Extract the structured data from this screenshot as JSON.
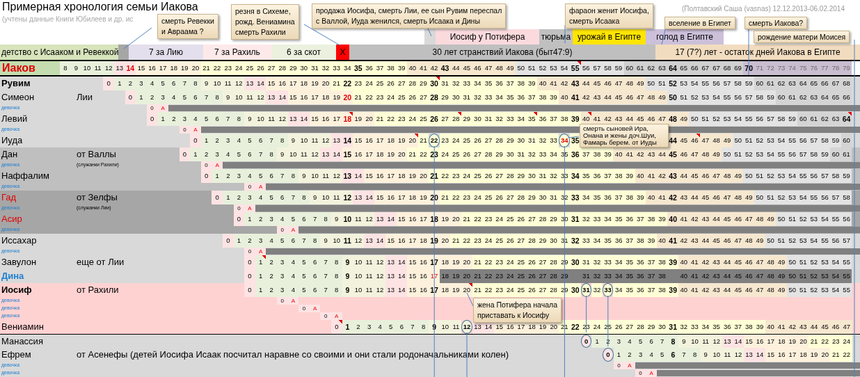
{
  "title": "Примерная хронология семьи Иакова",
  "subtitle": "(учтены данные Книги Юбилеев и др. ис",
  "author": "(Полтавский Саша (vasnas) 12.12.2013-06.02.2014",
  "periods_top": [
    {
      "color": "#d9d9d9"
    },
    {
      "text": "Иосиф у Потифера",
      "color": "#fadadd"
    },
    {
      "text": "тюрьма",
      "color": "#c0c0c0"
    },
    {
      "text": "урожай в Египте",
      "color": "#ffe500"
    },
    {
      "text": "голод в Египте",
      "color": "#ccc0da"
    }
  ],
  "periods": [
    {
      "text": "детство с Исааком и Ревеккой",
      "color": "#d7e4bc"
    },
    {
      "color": "#a6a6a6"
    },
    {
      "text": "7 за Лию",
      "color": "#e4dfec"
    },
    {
      "text": "7 за Рахиль",
      "color": "#fde9e9"
    },
    {
      "text": "6 за скот",
      "color": "#ebf1de"
    },
    {
      "text": "X",
      "color": "#ff0000"
    },
    {
      "text": "30 лет странствий Иакова (быт47:9)",
      "color": "#bfbfbf"
    },
    {
      "text": "17 (7?) лет - остаток дней Иакова в Египте",
      "color": "#f2dcc0"
    }
  ],
  "jacob": {
    "name": "Иаков",
    "cells": [
      "8",
      "9",
      "10",
      "11",
      "12",
      "13",
      {
        "t": "14",
        "bold": true,
        "red": true
      },
      "15",
      "16",
      "17",
      "18",
      "19",
      "20",
      "21",
      "22",
      "23",
      "24",
      "25",
      "26",
      "27",
      "28",
      "29",
      "30",
      "31",
      "32",
      "33",
      "34",
      {
        "t": "35",
        "bold": true
      },
      "36",
      "37",
      "38",
      "39",
      "40",
      "41",
      "42",
      {
        "t": "43",
        "bold": true
      },
      "44",
      "45",
      "46",
      "47",
      "48",
      "49",
      "50",
      "51",
      "52",
      "53",
      "54",
      {
        "t": "55",
        "bold": true,
        "flag": true
      },
      "56",
      "57",
      "58",
      "59",
      "60",
      "61",
      "62",
      "63",
      {
        "t": "64",
        "bold": true
      },
      "65",
      "66",
      "67",
      "67",
      "68",
      "69",
      {
        "t": "70",
        "bold": true
      },
      {
        "t": "71",
        "dim": true
      },
      {
        "t": "72",
        "dim": true
      },
      {
        "t": "73",
        "dim": true
      },
      {
        "t": "74",
        "dim": true
      },
      {
        "t": "75",
        "dim": true
      },
      {
        "t": "76",
        "dim": true
      },
      {
        "t": "77",
        "dim": true
      },
      {
        "t": "78",
        "dim": true
      },
      {
        "t": "79",
        "dim": true
      }
    ]
  },
  "rows": [
    {
      "kind": "son",
      "name": "Рувим",
      "bold": true,
      "color": "#d9d9d9",
      "cells": [
        null,
        null,
        null,
        null,
        "0",
        "1",
        "2",
        "3",
        "4",
        "5",
        "6",
        "7",
        "8",
        "9",
        "10",
        "11",
        "12",
        "13",
        "14",
        "15",
        "16",
        "17",
        "18",
        "19",
        "20",
        "21",
        {
          "t": "22",
          "bold": true
        },
        "23",
        "24",
        "25",
        "26",
        "27",
        "28",
        "29",
        {
          "t": "30",
          "bold": true,
          "flag": true
        },
        "31",
        "32",
        "33",
        "34",
        "35",
        "36",
        "37",
        "38",
        "39",
        "40",
        "41",
        "42",
        {
          "t": "43",
          "bold": true
        },
        "44",
        "45",
        "46",
        "47",
        "48",
        "49",
        "50",
        "51",
        {
          "t": "52",
          "bold": true
        },
        "53",
        "54",
        "55",
        "56",
        "57",
        "58",
        "59",
        "60",
        "61",
        "62",
        "63",
        "64",
        "65",
        "66",
        "67",
        "68"
      ]
    },
    {
      "kind": "son",
      "name": "Симеон",
      "color": "#d9d9d9",
      "note": "Лии",
      "cells": [
        null,
        null,
        null,
        null,
        null,
        null,
        "0",
        "1",
        "2",
        "3",
        "4",
        "5",
        "6",
        "7",
        "8",
        "9",
        "10",
        "11",
        "12",
        "13",
        "14",
        "15",
        "16",
        "17",
        "18",
        "19",
        {
          "t": "20",
          "bold": true,
          "red": true
        },
        "21",
        "22",
        "23",
        "24",
        "25",
        "26",
        "27",
        {
          "t": "28",
          "bold": true
        },
        "29",
        "30",
        "31",
        "32",
        "33",
        "34",
        "35",
        "36",
        "37",
        "38",
        "39",
        "40",
        {
          "t": "41",
          "bold": true
        },
        "42",
        "43",
        "44",
        "45",
        "46",
        "47",
        "48",
        "49",
        {
          "t": "50",
          "bold": true
        },
        "51",
        "52",
        "53",
        "54",
        "55",
        "56",
        "57",
        "58",
        "59",
        "60",
        "61",
        "62",
        "63",
        "64",
        "65",
        "66"
      ]
    },
    {
      "kind": "girl",
      "name": "девочка",
      "color": "#d9d9d9",
      "bar": true,
      "cells": [
        null,
        null,
        null,
        null,
        null,
        null,
        null,
        null,
        "0",
        {
          "t": "A",
          "red": true
        }
      ]
    },
    {
      "kind": "son",
      "name": "Левий",
      "color": "#d9d9d9",
      "cells": [
        null,
        null,
        null,
        null,
        null,
        null,
        null,
        null,
        "0",
        "1",
        "2",
        "3",
        "4",
        "5",
        "6",
        "7",
        "8",
        "9",
        "10",
        "11",
        "12",
        "13",
        "14",
        "15",
        "16",
        "17",
        {
          "t": "18",
          "bold": true,
          "red": true,
          "flag": true
        },
        "19",
        "20",
        "21",
        "22",
        "23",
        "24",
        "25",
        {
          "t": "26",
          "bold": true
        },
        "27",
        {
          "t": "28",
          "flag": true
        },
        "29",
        "30",
        "31",
        "32",
        "33",
        "34",
        {
          "t": "35",
          "flag": true
        },
        "36",
        "37",
        "38",
        {
          "t": "39",
          "bold": true
        },
        {
          "t": "40",
          "flag": true
        },
        "41",
        "42",
        "43",
        "44",
        "45",
        "46",
        "47",
        {
          "t": "48",
          "bold": true
        },
        "49",
        "50",
        "51",
        "52",
        "53",
        "54",
        "55",
        "56",
        "57",
        "58",
        "59",
        "60",
        "61",
        "62",
        "63",
        {
          "t": "64",
          "bold": true,
          "flag": true
        }
      ]
    },
    {
      "kind": "girl",
      "name": "девочка",
      "color": "#d9d9d9",
      "bar": true,
      "cells": [
        null,
        null,
        null,
        null,
        null,
        null,
        null,
        null,
        null,
        null,
        null,
        "0",
        {
          "t": "A",
          "red": true
        }
      ]
    },
    {
      "kind": "son",
      "name": "Иуда",
      "color": "#d9d9d9",
      "cells": [
        null,
        null,
        null,
        null,
        null,
        null,
        null,
        null,
        null,
        null,
        null,
        null,
        "0",
        "1",
        "2",
        "3",
        "4",
        "5",
        "6",
        "7",
        "8",
        "9",
        "10",
        "11",
        "12",
        "13",
        {
          "t": "14",
          "bold": true
        },
        "15",
        "16",
        "17",
        "18",
        "19",
        {
          "t": "20",
          "flag": true
        },
        "21",
        {
          "t": "22",
          "circled": true
        },
        "23",
        "24",
        "25",
        "26",
        "27",
        "28",
        "29",
        "30",
        "31",
        "32",
        "33",
        {
          "t": "34",
          "circled": true,
          "red": true
        },
        {
          "t": "35",
          "bold": true
        },
        null,
        null,
        null,
        null,
        null,
        null,
        null,
        null,
        {
          "t": "44",
          "bold": true
        },
        "45",
        {
          "t": "46",
          "flag": true
        },
        "47",
        "48",
        "49",
        "50",
        "51",
        "52",
        "53",
        "54",
        "55",
        "56",
        "57",
        "58",
        "59",
        "60"
      ]
    },
    {
      "kind": "son",
      "name": "Дан",
      "color": "#bfbfbf",
      "note": "от Валлы",
      "cells": [
        null,
        null,
        null,
        null,
        null,
        null,
        null,
        null,
        null,
        null,
        null,
        "0",
        "1",
        "2",
        "3",
        "4",
        "5",
        "6",
        "7",
        "8",
        "9",
        "10",
        "11",
        "12",
        "13",
        "14",
        {
          "t": "15",
          "bold": true
        },
        "16",
        "17",
        "18",
        "19",
        "20",
        "21",
        "22",
        {
          "t": "23",
          "bold": true
        },
        "24",
        "25",
        "26",
        "27",
        "28",
        "29",
        "30",
        "31",
        "32",
        "33",
        "34",
        "35",
        {
          "t": "36",
          "bold": true
        },
        "37",
        "38",
        "39",
        "40",
        "41",
        "42",
        "43",
        "44",
        {
          "t": "45",
          "bold": true
        },
        "46",
        "47",
        "48",
        "49",
        "50",
        "51",
        "52",
        "53",
        "54",
        "55",
        "56",
        "57",
        "58",
        "59",
        "60",
        "61"
      ]
    },
    {
      "kind": "girl",
      "name": "девочка",
      "color": "#bfbfbf",
      "bar": true,
      "note": "(служанки Рахили)",
      "cells": [
        null,
        null,
        null,
        null,
        null,
        null,
        null,
        null,
        null,
        null,
        null,
        null,
        null,
        "0",
        {
          "t": "A",
          "red": true
        }
      ]
    },
    {
      "kind": "son",
      "name": "Наффалим",
      "color": "#bfbfbf",
      "cells": [
        null,
        null,
        null,
        null,
        null,
        null,
        null,
        null,
        null,
        null,
        null,
        null,
        null,
        "0",
        "1",
        "2",
        "3",
        "4",
        "5",
        "6",
        "7",
        "8",
        "9",
        "10",
        "11",
        "12",
        {
          "t": "13",
          "bold": true
        },
        "14",
        "15",
        "16",
        "17",
        "18",
        "19",
        "20",
        {
          "t": "21",
          "bold": true
        },
        "22",
        "23",
        "24",
        "25",
        "26",
        "27",
        "28",
        "29",
        "30",
        "31",
        "32",
        "33",
        {
          "t": "34",
          "bold": true
        },
        "35",
        "36",
        "37",
        "38",
        "39",
        "40",
        "41",
        "42",
        {
          "t": "43",
          "bold": true
        },
        "44",
        "45",
        "46",
        "47",
        "48",
        "49",
        "50",
        "51",
        "52",
        "53",
        "54",
        "55",
        "56",
        "57",
        "58",
        "59"
      ]
    },
    {
      "kind": "girl",
      "name": "девочка",
      "color": "#bfbfbf",
      "bar": true,
      "cells": [
        null,
        null,
        null,
        null,
        null,
        null,
        null,
        null,
        null,
        null,
        null,
        null,
        null,
        null,
        null,
        null,
        null,
        "0",
        {
          "t": "A",
          "red": true
        }
      ]
    },
    {
      "kind": "son",
      "name": "Гад",
      "red": true,
      "color": "#a6a6a6",
      "note": "от Зелфы",
      "cells": [
        null,
        null,
        null,
        null,
        null,
        null,
        null,
        null,
        null,
        null,
        null,
        null,
        null,
        null,
        "0",
        "1",
        "2",
        "3",
        "4",
        "5",
        "6",
        "7",
        "8",
        "9",
        "10",
        "11",
        {
          "t": "12",
          "bold": true
        },
        "13",
        "14",
        "15",
        "16",
        "17",
        "18",
        "19",
        {
          "t": "20",
          "bold": true
        },
        "21",
        "22",
        "23",
        "24",
        "25",
        "26",
        "27",
        "28",
        "29",
        "30",
        "31",
        "32",
        {
          "t": "33",
          "bold": true
        },
        "34",
        "35",
        "36",
        "37",
        "38",
        "39",
        "40",
        "41",
        {
          "t": "42",
          "bold": true
        },
        "43",
        "44",
        "45",
        "46",
        "47",
        "48",
        "49",
        "50",
        "51",
        "52",
        "53",
        "54",
        "55",
        "56",
        "57",
        "58"
      ]
    },
    {
      "kind": "girl",
      "name": "девочка",
      "color": "#a6a6a6",
      "bar": true,
      "note": "(служанки Лии)",
      "cells": [
        null,
        null,
        null,
        null,
        null,
        null,
        null,
        null,
        null,
        null,
        null,
        null,
        null,
        null,
        null,
        null,
        "0",
        {
          "t": "A",
          "red": true
        }
      ]
    },
    {
      "kind": "son",
      "name": "Асир",
      "red": true,
      "color": "#a6a6a6",
      "cells": [
        null,
        null,
        null,
        null,
        null,
        null,
        null,
        null,
        null,
        null,
        null,
        null,
        null,
        null,
        null,
        null,
        "0",
        "1",
        "2",
        "3",
        "4",
        "5",
        "6",
        "7",
        "8",
        "9",
        {
          "t": "10",
          "bold": true
        },
        "11",
        "12",
        "13",
        "14",
        "15",
        "16",
        "17",
        {
          "t": "18",
          "bold": true
        },
        "19",
        "20",
        "21",
        "22",
        "23",
        "24",
        "25",
        "26",
        "27",
        "28",
        "29",
        "30",
        {
          "t": "31",
          "bold": true
        },
        "32",
        "33",
        "34",
        "35",
        "36",
        "37",
        "38",
        "39",
        {
          "t": "40",
          "bold": true
        },
        "41",
        "42",
        "43",
        "44",
        "45",
        "46",
        "47",
        "48",
        "49",
        "50",
        "51",
        "52",
        "53",
        "54",
        "55",
        "56"
      ]
    },
    {
      "kind": "girl",
      "name": "девочка",
      "color": "#a6a6a6",
      "bar": true,
      "cells": [
        null,
        null,
        null,
        null,
        null,
        null,
        null,
        null,
        null,
        null,
        null,
        null,
        null,
        null,
        null,
        null,
        null,
        null,
        null,
        null,
        "0",
        {
          "t": "A",
          "red": true
        }
      ]
    },
    {
      "kind": "son",
      "name": "Иссахар",
      "color": "#d9d9d9",
      "cells": [
        null,
        null,
        null,
        null,
        null,
        null,
        null,
        null,
        null,
        null,
        null,
        null,
        null,
        null,
        null,
        "0",
        "1",
        "2",
        "3",
        "4",
        "5",
        "6",
        "7",
        "8",
        "9",
        "10",
        {
          "t": "11",
          "bold": true
        },
        "12",
        "13",
        "14",
        "15",
        "16",
        "17",
        "18",
        {
          "t": "19",
          "bold": true
        },
        "20",
        "21",
        "22",
        "23",
        "24",
        "25",
        "26",
        "27",
        "28",
        "29",
        "30",
        "31",
        {
          "t": "32",
          "bold": true
        },
        "33",
        "34",
        "35",
        "36",
        "37",
        "38",
        "39",
        "40",
        {
          "t": "41",
          "bold": true
        },
        "42",
        "43",
        "44",
        "45",
        "46",
        "47",
        "48",
        "49",
        "50",
        "51",
        "52",
        "53",
        "54",
        "55",
        "56",
        "57"
      ]
    },
    {
      "kind": "girl",
      "name": "девочка",
      "color": "#d9d9d9",
      "bar": true,
      "cells": [
        null,
        null,
        null,
        null,
        null,
        null,
        null,
        null,
        null,
        null,
        null,
        null,
        null,
        null,
        null,
        null,
        null,
        "0",
        {
          "t": "A",
          "red": true
        }
      ]
    },
    {
      "kind": "son",
      "name": "Завулон",
      "color": "#d9d9d9",
      "note": "еще от Лии",
      "cells": [
        null,
        null,
        null,
        null,
        null,
        null,
        null,
        null,
        null,
        null,
        null,
        null,
        null,
        null,
        null,
        null,
        null,
        "0",
        {
          "t": "1",
          "flag": true
        },
        "2",
        "3",
        "4",
        "5",
        "6",
        "7",
        "8",
        {
          "t": "9",
          "bold": true
        },
        "10",
        "11",
        "12",
        "13",
        "14",
        "15",
        "16",
        {
          "t": "17",
          "bold": true
        },
        "18",
        "19",
        "20",
        "21",
        "22",
        "23",
        "24",
        "25",
        "26",
        "27",
        "28",
        "29",
        {
          "t": "30",
          "bold": true
        },
        "31",
        "32",
        "33",
        "34",
        "35",
        "36",
        "37",
        "38",
        {
          "t": "39",
          "bold": true
        },
        "40",
        "41",
        "42",
        "43",
        "44",
        "45",
        "46",
        "47",
        "48",
        "49",
        "50",
        "51",
        "52",
        "53",
        "54",
        "55"
      ]
    },
    {
      "kind": "daughter",
      "name": "Дина",
      "blue": true,
      "color": "#d9d9d9",
      "grayed_out": true,
      "cells": [
        null,
        null,
        null,
        null,
        null,
        null,
        null,
        null,
        null,
        null,
        null,
        null,
        null,
        null,
        null,
        null,
        null,
        "0",
        "1",
        "2",
        "3",
        "4",
        "5",
        "6",
        "7",
        "8",
        {
          "t": "9",
          "bold": true
        },
        "10",
        "11",
        "12",
        "13",
        "14",
        "15",
        "16",
        {
          "t": "17",
          "red": true
        },
        "18",
        "19",
        "20",
        "21",
        "22",
        "23",
        "24",
        "25",
        "26",
        "27",
        "28",
        "29",
        null,
        "31",
        "32",
        "33",
        "34",
        "35",
        "36",
        "37",
        "38",
        null,
        "40",
        "41",
        "42",
        "43",
        "44",
        "45",
        "46",
        "47",
        "48",
        "49",
        "50",
        "51",
        "52",
        "53",
        "54",
        "55"
      ]
    },
    {
      "kind": "son",
      "name": "Иосиф",
      "bold": true,
      "color": "#ffd2d2",
      "note": "от Рахили",
      "cells": [
        null,
        null,
        null,
        null,
        null,
        null,
        null,
        null,
        null,
        null,
        null,
        null,
        null,
        null,
        null,
        null,
        null,
        "0",
        "1",
        "2",
        "3",
        "4",
        "5",
        "6",
        "7",
        "8",
        {
          "t": "9",
          "bold": true
        },
        "10",
        "11",
        "12",
        "13",
        "14",
        "15",
        "16",
        {
          "t": "17",
          "bold": true
        },
        "18",
        "19",
        {
          "t": "20",
          "flag": true
        },
        "21",
        "22",
        "23",
        "24",
        "25",
        "26",
        "27",
        "28",
        "29",
        {
          "t": "30",
          "bold": true
        },
        {
          "t": "31",
          "circled": true
        },
        "32",
        {
          "t": "33",
          "circled": true
        },
        "34",
        "35",
        "36",
        "37",
        "38",
        {
          "t": "39",
          "bold": true
        },
        "40",
        "41",
        "42",
        "43",
        "44",
        "45",
        "46",
        "47",
        "48",
        "49",
        "50",
        "51",
        "52",
        "53",
        "54",
        "55"
      ]
    },
    {
      "kind": "girl",
      "name": "девочка",
      "color": "#ffd2d2",
      "bar": false,
      "cells": [
        null,
        null,
        null,
        null,
        null,
        null,
        null,
        null,
        null,
        null,
        null,
        null,
        null,
        null,
        null,
        null,
        null,
        null,
        null,
        null,
        "0",
        {
          "t": "A",
          "red": true
        }
      ]
    },
    {
      "kind": "girl",
      "name": "девочка",
      "color": "#ffd2d2",
      "bar": false,
      "cells": [
        null,
        null,
        null,
        null,
        null,
        null,
        null,
        null,
        null,
        null,
        null,
        null,
        null,
        null,
        null,
        null,
        null,
        null,
        null,
        null,
        null,
        null,
        "0",
        {
          "t": "A",
          "red": true
        }
      ]
    },
    {
      "kind": "girl",
      "name": "девочка",
      "color": "#ffd2d2",
      "bar": false,
      "cells": [
        null,
        null,
        null,
        null,
        null,
        null,
        null,
        null,
        null,
        null,
        null,
        null,
        null,
        null,
        null,
        null,
        null,
        null,
        null,
        null,
        null,
        null,
        null,
        null,
        "0",
        {
          "t": "A",
          "red": true
        }
      ]
    },
    {
      "kind": "son",
      "name": "Вениамин",
      "color": "#ffd2d2",
      "cells": [
        null,
        null,
        null,
        null,
        null,
        null,
        null,
        null,
        null,
        null,
        null,
        null,
        null,
        null,
        null,
        null,
        null,
        null,
        null,
        null,
        null,
        null,
        null,
        null,
        null,
        {
          "t": "0",
          "flag": true
        },
        {
          "t": "1",
          "bold": true
        },
        "2",
        "3",
        "4",
        "5",
        "6",
        "7",
        "8",
        {
          "t": "9",
          "bold": true
        },
        "10",
        "11",
        {
          "t": "12",
          "circled": true
        },
        "13",
        "14",
        "15",
        "16",
        "17",
        "18",
        "19",
        "20",
        "21",
        {
          "t": "22",
          "bold": true
        },
        "23",
        "24",
        "25",
        "26",
        "27",
        "28",
        "29",
        "30",
        {
          "t": "31",
          "bold": true
        },
        "32",
        "33",
        "34",
        "35",
        "36",
        "37",
        "38",
        "39",
        "40",
        "41",
        "42",
        "43",
        "44",
        "45",
        "46",
        "47"
      ]
    },
    {
      "kind": "son",
      "name": "Манассия",
      "separator_above": true,
      "color": "#d9d9d9",
      "cells": [
        null,
        null,
        null,
        null,
        null,
        null,
        null,
        null,
        null,
        null,
        null,
        null,
        null,
        null,
        null,
        null,
        null,
        null,
        null,
        null,
        null,
        null,
        null,
        null,
        null,
        null,
        null,
        null,
        null,
        null,
        null,
        null,
        null,
        null,
        null,
        null,
        null,
        null,
        null,
        null,
        null,
        null,
        null,
        null,
        null,
        null,
        null,
        null,
        {
          "t": "0",
          "circled": true
        },
        "1",
        "2",
        "3",
        "4",
        "5",
        "6",
        "7",
        {
          "t": "8",
          "bold": true
        },
        "9",
        "10",
        "11",
        "12",
        "13",
        "14",
        "15",
        "16",
        "17",
        "18",
        "19",
        "20",
        "21",
        "22",
        "23",
        "24"
      ]
    },
    {
      "kind": "son",
      "name": "Ефрем",
      "color": "#d9d9d9",
      "note": "от Асенефы (детей Иосифа Исаак посчитал наравне со своими и они стали родоначальниками колен)",
      "cells": [
        null,
        null,
        null,
        null,
        null,
        null,
        null,
        null,
        null,
        null,
        null,
        null,
        null,
        null,
        null,
        null,
        null,
        null,
        null,
        null,
        null,
        null,
        null,
        null,
        null,
        null,
        null,
        null,
        null,
        null,
        null,
        null,
        null,
        null,
        null,
        null,
        null,
        null,
        null,
        null,
        null,
        null,
        null,
        null,
        null,
        null,
        null,
        null,
        null,
        null,
        {
          "t": "0",
          "circled": true
        },
        "1",
        "2",
        "3",
        "4",
        "5",
        {
          "t": "6",
          "bold": true
        },
        "7",
        "8",
        "9",
        "10",
        "11",
        "12",
        "13",
        "14",
        "15",
        "16",
        "17",
        "18",
        "19",
        "20",
        "21",
        "22"
      ]
    },
    {
      "kind": "girl",
      "name": "девочка",
      "color": "#d9d9d9",
      "bar": true,
      "cells": [
        null,
        null,
        null,
        null,
        null,
        null,
        null,
        null,
        null,
        null,
        null,
        null,
        null,
        null,
        null,
        null,
        null,
        null,
        null,
        null,
        null,
        null,
        null,
        null,
        null,
        null,
        null,
        null,
        null,
        null,
        null,
        null,
        null,
        null,
        null,
        null,
        null,
        null,
        null,
        null,
        null,
        null,
        null,
        null,
        null,
        null,
        null,
        null,
        null,
        null,
        null,
        "0",
        {
          "t": "A",
          "red": true
        }
      ]
    },
    {
      "kind": "girl",
      "name": "девочка",
      "color": "#d9d9d9",
      "bar": true,
      "cells": [
        null,
        null,
        null,
        null,
        null,
        null,
        null,
        null,
        null,
        null,
        null,
        null,
        null,
        null,
        null,
        null,
        null,
        null,
        null,
        null,
        null,
        null,
        null,
        null,
        null,
        null,
        null,
        null,
        null,
        null,
        null,
        null,
        null,
        null,
        null,
        null,
        null,
        null,
        null,
        null,
        null,
        null,
        null,
        null,
        null,
        null,
        null,
        null,
        null,
        null,
        null,
        null,
        null,
        "0",
        {
          "t": "A",
          "red": true
        }
      ]
    }
  ],
  "callouts": [
    {
      "text": "смерть Ревекки\nи Авраама ?"
    },
    {
      "text": "резня в Сихеме,\nрожд. Вениамина\nсмерть Рахили"
    },
    {
      "text": "продажа Иосифа, смерть Лии, ее сын Рувим переспал\nс Валлой, Иуда женился, смерть Исаака и Дины"
    },
    {
      "text": "фараон женит Иосифа,\nсмерть Исаака"
    },
    {
      "text": "вселение в Египет"
    },
    {
      "text": "смерть Иакова?"
    },
    {
      "text": "рождение матери Моисея"
    },
    {
      "text": "смерть сыновей Ира,\nОнана и жены доч.Шуи,\nФамарь берем. от Иуды"
    },
    {
      "text": "жена Потифера начала\nприставать к Иосифу"
    }
  ]
}
